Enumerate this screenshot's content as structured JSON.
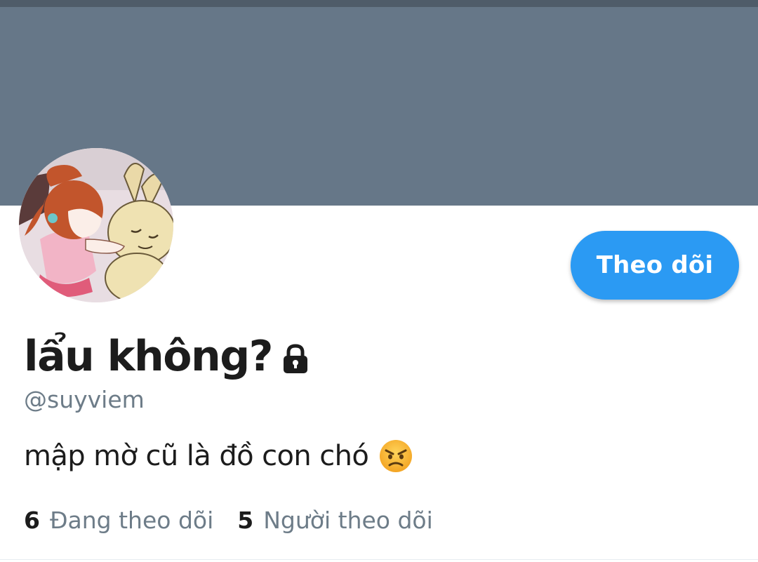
{
  "header": {
    "banner_color": "#667788",
    "status_strip_color": "#4f5c69"
  },
  "avatar": {
    "icon": "profile-photo-girl-hugging-rabbit"
  },
  "follow_button": {
    "label": "Theo dõi",
    "color": "#2b9af3"
  },
  "profile": {
    "display_name": "lẩu không?",
    "protected_icon": "lock-icon",
    "handle": "@suyviem",
    "bio": "mập mờ cũ là đồ con chó",
    "bio_emoji": "angry-face-emoji"
  },
  "stats": [
    {
      "count": "6",
      "label": "Đang theo dõi"
    },
    {
      "count": "5",
      "label": "Người theo dõi"
    }
  ],
  "colors": {
    "primary_text": "#1c1c1c",
    "secondary_text": "#6d7c88"
  }
}
